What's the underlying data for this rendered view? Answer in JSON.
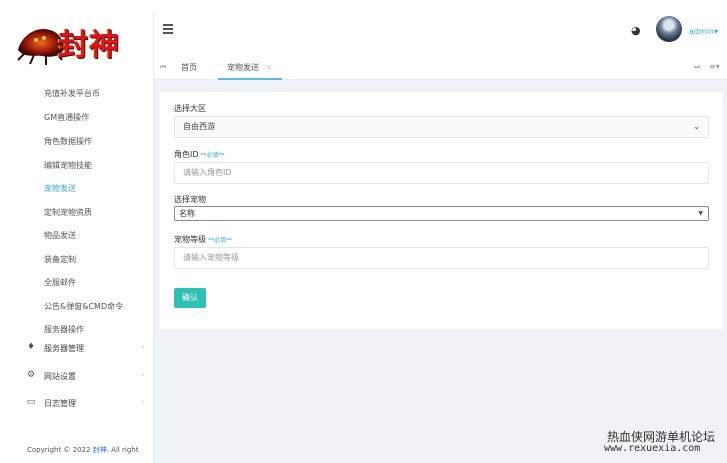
{
  "logo": {
    "text": "封神"
  },
  "sidebar": {
    "items": [
      {
        "label": "充值补发平台币"
      },
      {
        "label": "GM直通操作"
      },
      {
        "label": "角色数据操作"
      },
      {
        "label": "编辑宠物技能"
      },
      {
        "label": "宠物发送",
        "active": true
      },
      {
        "label": "定制宠物资质"
      },
      {
        "label": "物品发送"
      },
      {
        "label": "装备定制"
      },
      {
        "label": "全服邮件"
      },
      {
        "label": "公告&弹窗&CMD命令"
      },
      {
        "label": "服务器操作"
      }
    ],
    "groups": [
      {
        "label": "服务器管理",
        "icon": "diamond-icon"
      },
      {
        "label": "网站设置",
        "icon": "gear-icon"
      },
      {
        "label": "日志管理",
        "icon": "message-icon"
      }
    ],
    "copyright_prefix": "Copyright © 2022 ",
    "copyright_brand": "封神",
    "copyright_suffix": ". All right"
  },
  "header": {
    "user": "admin",
    "tabs": [
      {
        "label": "首页"
      },
      {
        "label": "宠物发送",
        "active": true
      }
    ]
  },
  "form": {
    "region_label": "选择大区",
    "region_value": "自由西游",
    "role_id_label": "角色ID",
    "role_id_required": "**必填**",
    "role_id_placeholder": "请输入角色ID",
    "pet_label": "选择宠物",
    "pet_value": "名称",
    "pet_level_label": "宠物等级",
    "pet_level_required": "**必填**",
    "pet_level_placeholder": "请输入宠物等级",
    "confirm_label": "确认"
  },
  "watermark": {
    "line1": "热血侠网游单机论坛",
    "line2": "www.rexuexia.com"
  },
  "colors": {
    "accent": "#3ca8d0",
    "button": "#2fc0b4"
  }
}
